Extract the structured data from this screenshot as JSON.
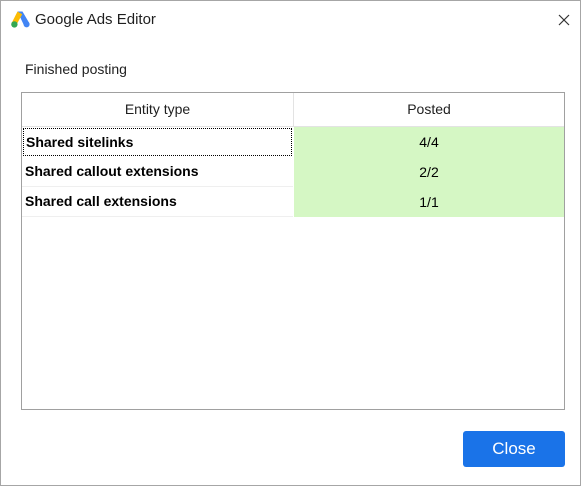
{
  "window": {
    "title": "Google Ads Editor"
  },
  "status": {
    "text": "Finished posting"
  },
  "table": {
    "columns": [
      "Entity type",
      "Posted"
    ],
    "rows": [
      {
        "entity": "Shared sitelinks",
        "posted": "4/4"
      },
      {
        "entity": "Shared callout extensions",
        "posted": "2/2"
      },
      {
        "entity": "Shared call extensions",
        "posted": "1/1"
      }
    ]
  },
  "buttons": {
    "close_label": "Close"
  },
  "icons": {
    "app": "google-ads-logo-icon",
    "close": "close-icon"
  },
  "colors": {
    "accent": "#1a73e8",
    "success_cell": "#d5f7c4"
  }
}
